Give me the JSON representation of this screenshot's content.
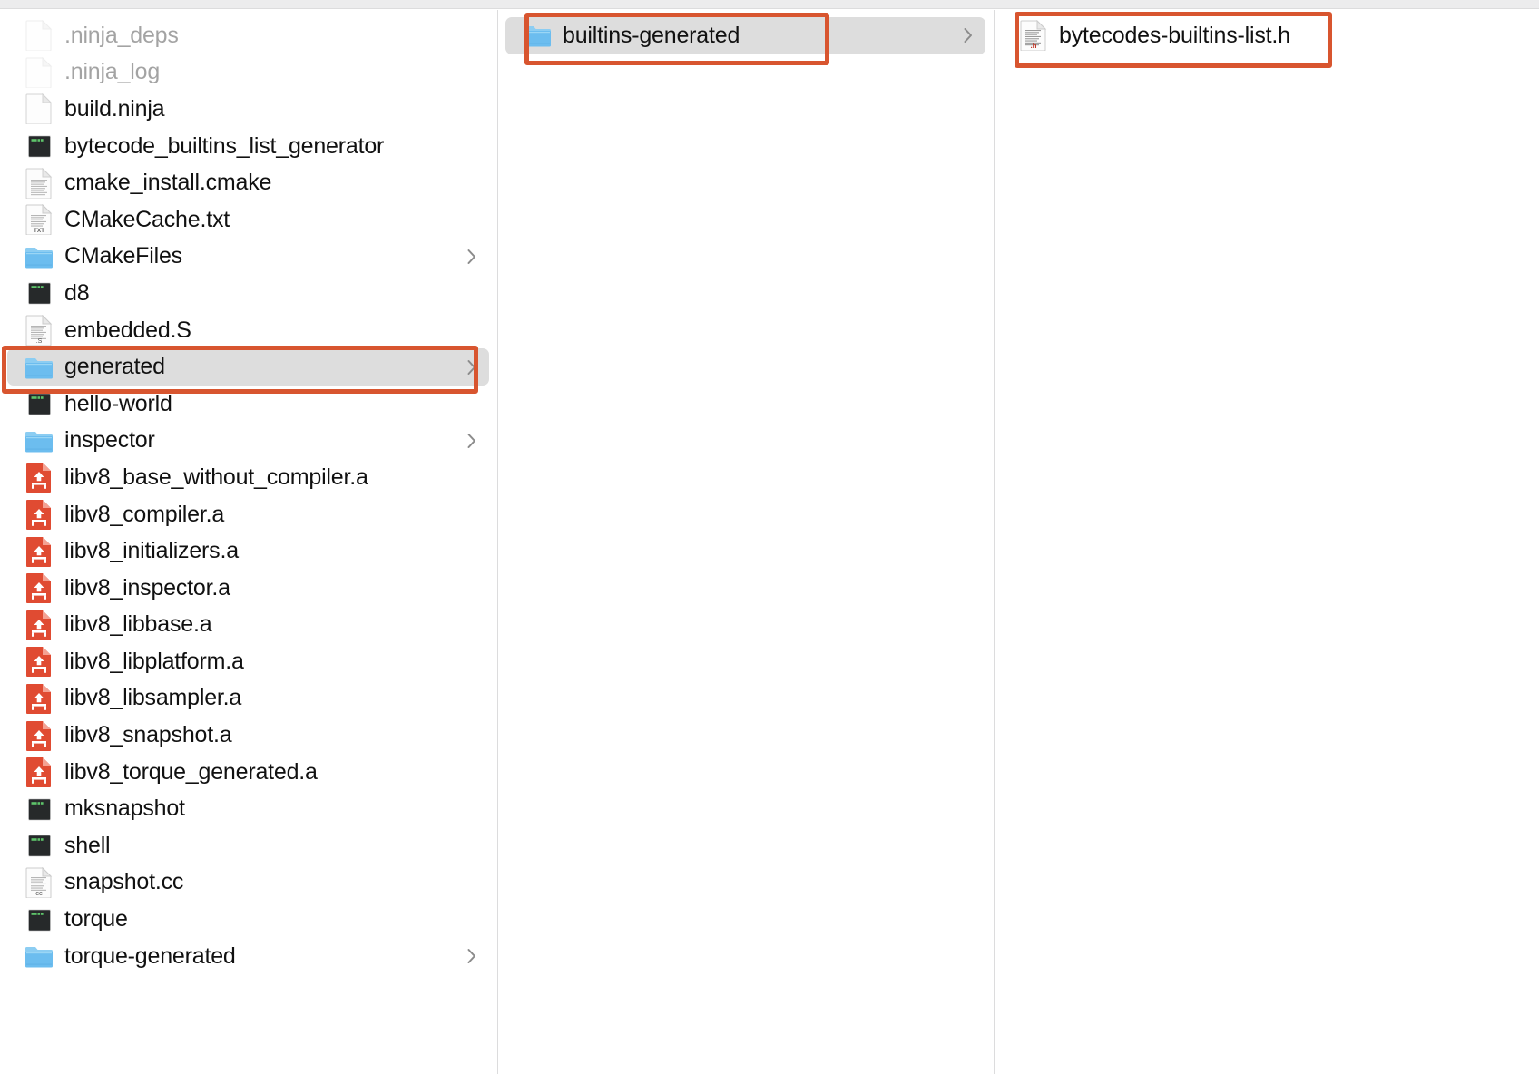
{
  "window": {
    "view_mode": "column-view",
    "accent_selection_color": "#dddddd",
    "annotation_color": "#d8552f"
  },
  "columns": [
    {
      "id": "column-build-dir",
      "items": [
        {
          "name": ".ninja_deps",
          "icon": "generic-file-icon",
          "hidden": true,
          "selected": false,
          "has_children": false
        },
        {
          "name": ".ninja_log",
          "icon": "generic-file-icon",
          "hidden": true,
          "selected": false,
          "has_children": false
        },
        {
          "name": "build.ninja",
          "icon": "generic-file-icon",
          "hidden": false,
          "selected": false,
          "has_children": false
        },
        {
          "name": "bytecode_builtins_list_generator",
          "icon": "executable-icon",
          "hidden": false,
          "selected": false,
          "has_children": false
        },
        {
          "name": "cmake_install.cmake",
          "icon": "text-document-icon",
          "hidden": false,
          "selected": false,
          "has_children": false
        },
        {
          "name": "CMakeCache.txt",
          "icon": "txt-document-icon",
          "hidden": false,
          "selected": false,
          "has_children": false
        },
        {
          "name": "CMakeFiles",
          "icon": "folder-icon",
          "hidden": false,
          "selected": false,
          "has_children": true
        },
        {
          "name": "d8",
          "icon": "executable-icon",
          "hidden": false,
          "selected": false,
          "has_children": false
        },
        {
          "name": "embedded.S",
          "icon": "asm-document-icon",
          "hidden": false,
          "selected": false,
          "has_children": false
        },
        {
          "name": "generated",
          "icon": "folder-icon",
          "hidden": false,
          "selected": true,
          "has_children": true
        },
        {
          "name": "hello-world",
          "icon": "executable-icon",
          "hidden": false,
          "selected": false,
          "has_children": false
        },
        {
          "name": "inspector",
          "icon": "folder-icon",
          "hidden": false,
          "selected": false,
          "has_children": true
        },
        {
          "name": "libv8_base_without_compiler.a",
          "icon": "archive-icon",
          "hidden": false,
          "selected": false,
          "has_children": false
        },
        {
          "name": "libv8_compiler.a",
          "icon": "archive-icon",
          "hidden": false,
          "selected": false,
          "has_children": false
        },
        {
          "name": "libv8_initializers.a",
          "icon": "archive-icon",
          "hidden": false,
          "selected": false,
          "has_children": false
        },
        {
          "name": "libv8_inspector.a",
          "icon": "archive-icon",
          "hidden": false,
          "selected": false,
          "has_children": false
        },
        {
          "name": "libv8_libbase.a",
          "icon": "archive-icon",
          "hidden": false,
          "selected": false,
          "has_children": false
        },
        {
          "name": "libv8_libplatform.a",
          "icon": "archive-icon",
          "hidden": false,
          "selected": false,
          "has_children": false
        },
        {
          "name": "libv8_libsampler.a",
          "icon": "archive-icon",
          "hidden": false,
          "selected": false,
          "has_children": false
        },
        {
          "name": "libv8_snapshot.a",
          "icon": "archive-icon",
          "hidden": false,
          "selected": false,
          "has_children": false
        },
        {
          "name": "libv8_torque_generated.a",
          "icon": "archive-icon",
          "hidden": false,
          "selected": false,
          "has_children": false
        },
        {
          "name": "mksnapshot",
          "icon": "executable-icon",
          "hidden": false,
          "selected": false,
          "has_children": false
        },
        {
          "name": "shell",
          "icon": "executable-icon",
          "hidden": false,
          "selected": false,
          "has_children": false
        },
        {
          "name": "snapshot.cc",
          "icon": "cc-document-icon",
          "hidden": false,
          "selected": false,
          "has_children": false
        },
        {
          "name": "torque",
          "icon": "executable-icon",
          "hidden": false,
          "selected": false,
          "has_children": false
        },
        {
          "name": "torque-generated",
          "icon": "folder-icon",
          "hidden": false,
          "selected": false,
          "has_children": true
        }
      ]
    },
    {
      "id": "column-generated",
      "items": [
        {
          "name": "builtins-generated",
          "icon": "folder-icon",
          "hidden": false,
          "selected": true,
          "has_children": true
        }
      ]
    },
    {
      "id": "column-builtins-generated",
      "items": [
        {
          "name": "bytecodes-builtins-list.h",
          "icon": "h-header-document-icon",
          "hidden": false,
          "selected": false,
          "has_children": false
        }
      ]
    }
  ],
  "annotations": [
    {
      "id": "annotation-generated",
      "target": "generated"
    },
    {
      "id": "annotation-builtins",
      "target": "builtins-generated"
    },
    {
      "id": "annotation-bytecodes",
      "target": "bytecodes-builtins-list.h"
    }
  ]
}
